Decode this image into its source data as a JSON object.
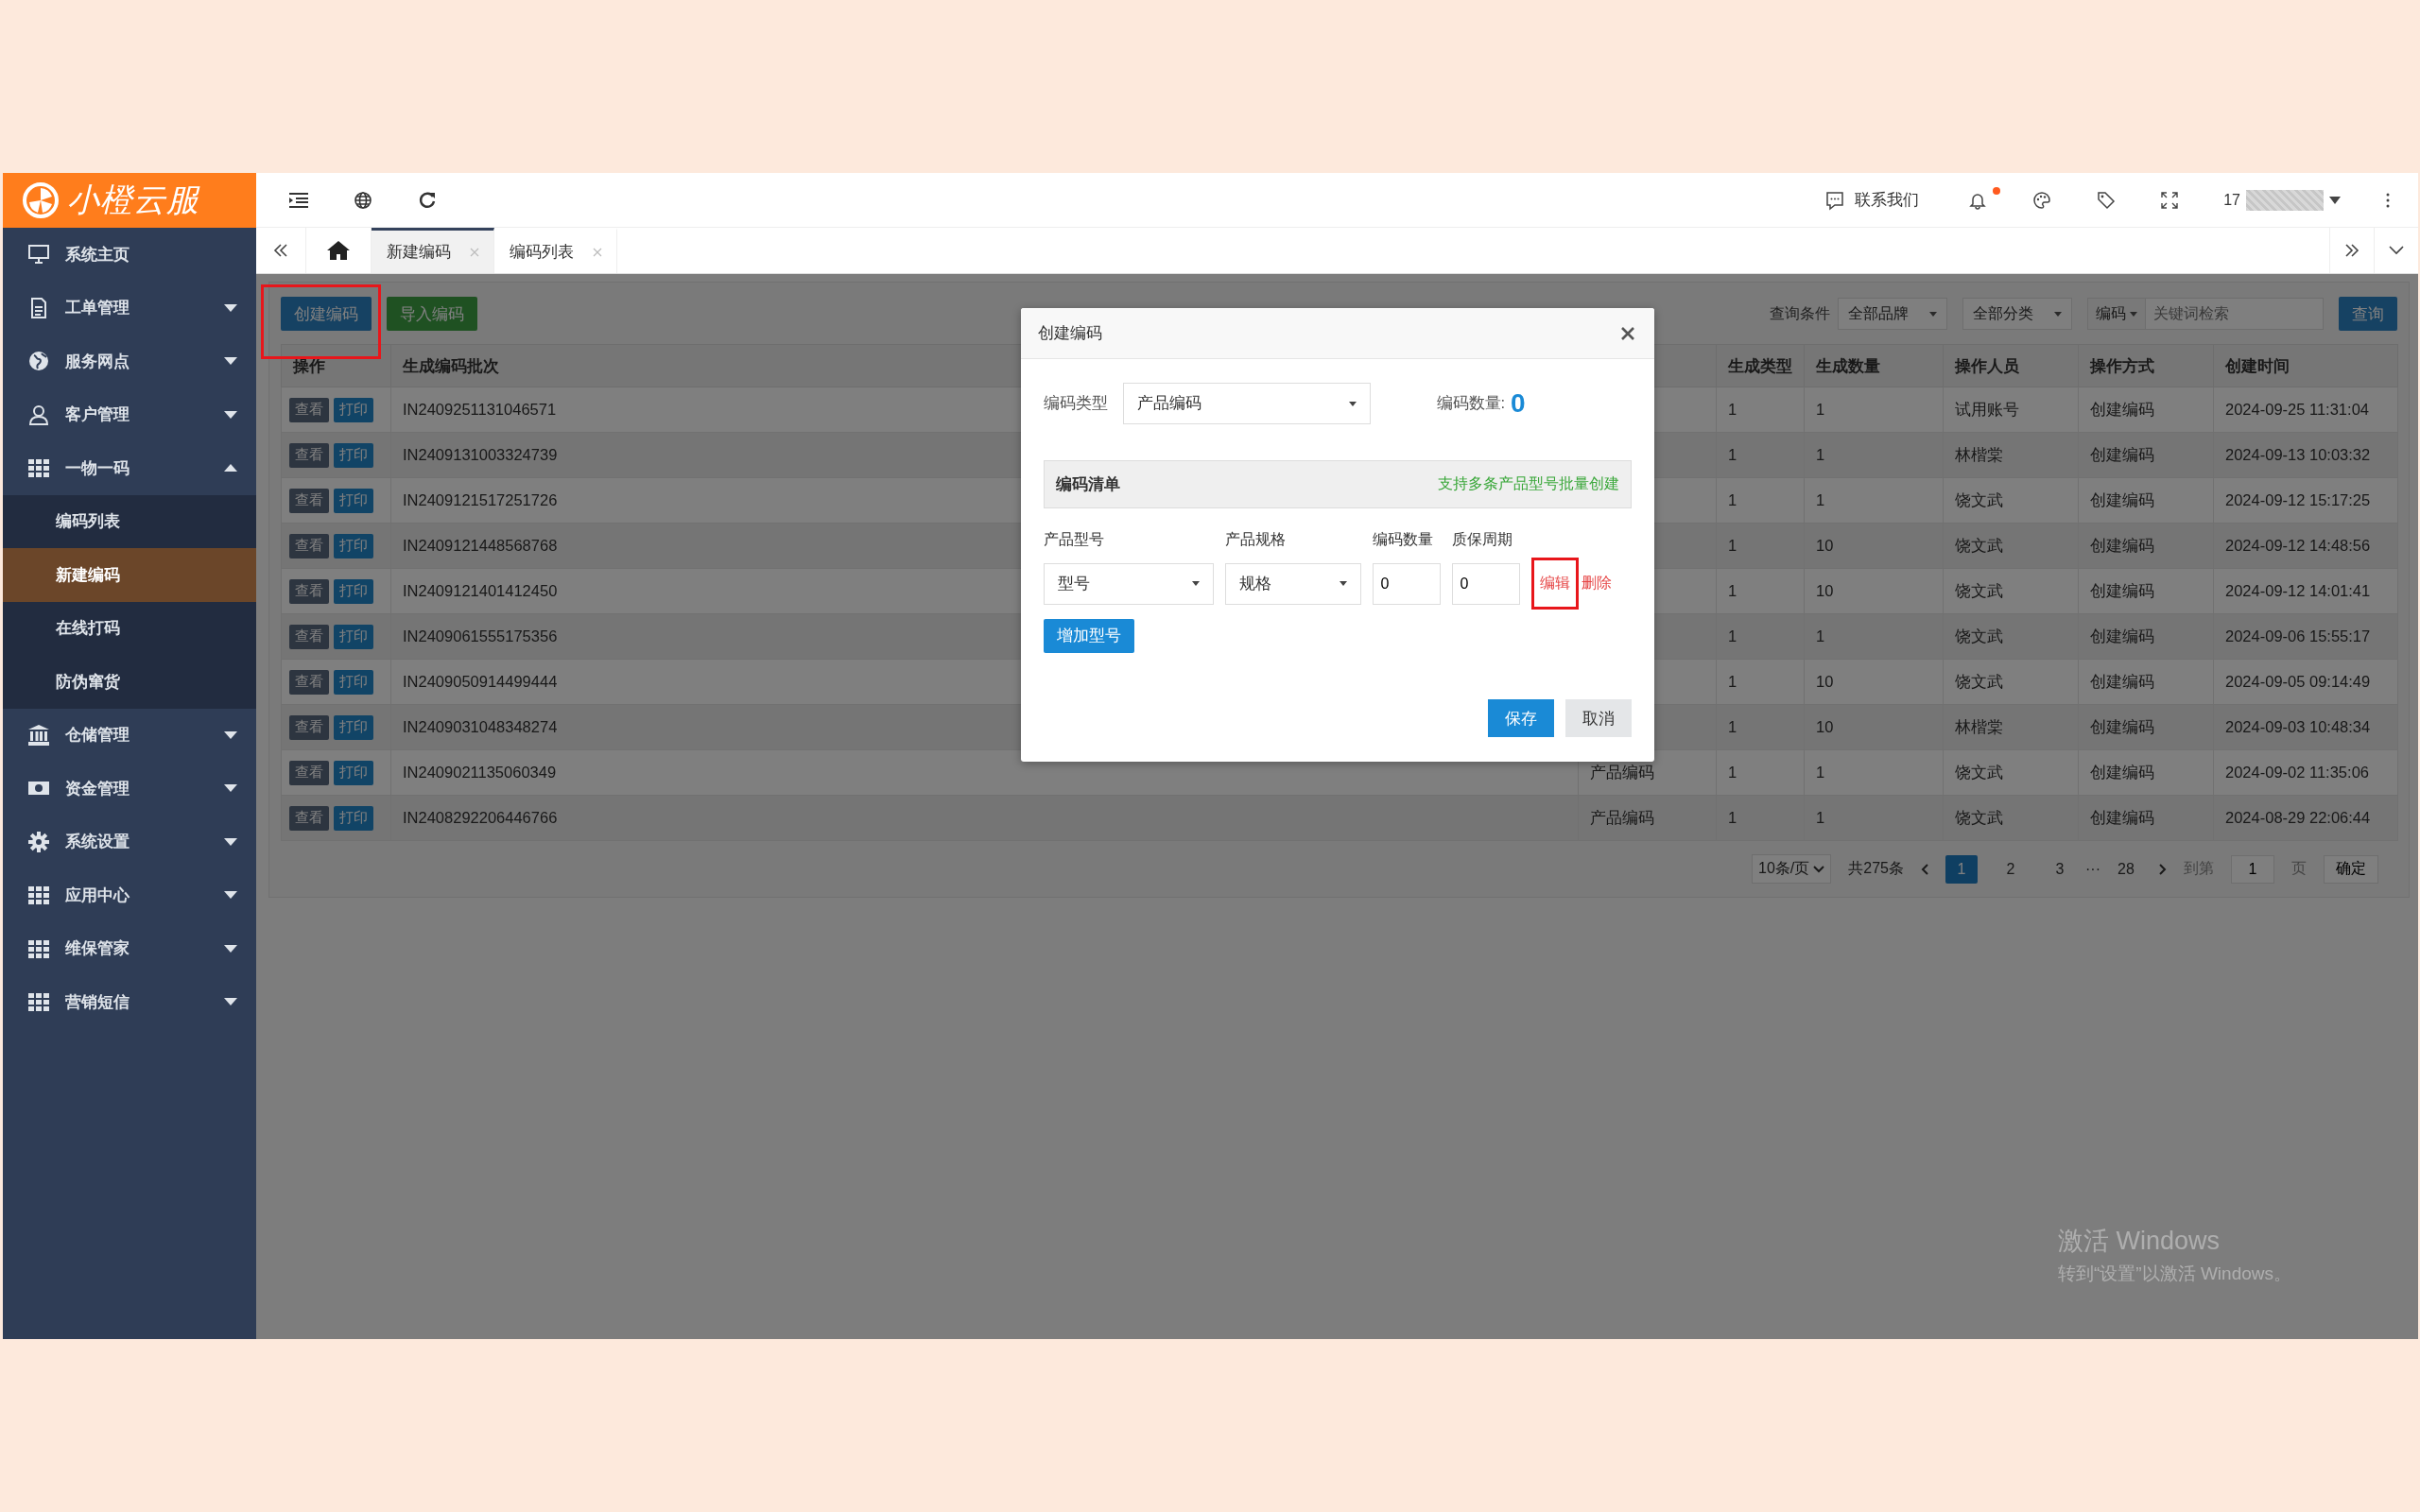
{
  "logo": {
    "text": "小橙云服"
  },
  "sidebar": {
    "items": [
      {
        "label": "系统主页",
        "kind": "link"
      },
      {
        "label": "工单管理",
        "kind": "menu",
        "expanded": false
      },
      {
        "label": "服务网点",
        "kind": "menu",
        "expanded": false
      },
      {
        "label": "客户管理",
        "kind": "menu",
        "expanded": false
      },
      {
        "label": "一物一码",
        "kind": "menu",
        "expanded": true,
        "children": [
          {
            "label": "编码列表",
            "selected": false
          },
          {
            "label": "新建编码",
            "selected": true
          },
          {
            "label": "在线打码",
            "selected": false
          },
          {
            "label": "防伪窜货",
            "selected": false
          }
        ]
      },
      {
        "label": "仓储管理",
        "kind": "menu",
        "expanded": false
      },
      {
        "label": "资金管理",
        "kind": "menu",
        "expanded": false
      },
      {
        "label": "系统设置",
        "kind": "menu",
        "expanded": false
      },
      {
        "label": "应用中心",
        "kind": "menu",
        "expanded": false
      },
      {
        "label": "维保管家",
        "kind": "menu",
        "expanded": false
      },
      {
        "label": "营销短信",
        "kind": "menu",
        "expanded": false
      }
    ]
  },
  "header": {
    "contact": "联系我们",
    "unread": true,
    "user": "17"
  },
  "tabs": [
    {
      "label": "新建编码",
      "selected": true
    },
    {
      "label": "编码列表",
      "selected": false
    }
  ],
  "toolbar": {
    "buttons": [
      {
        "label": "创建编码",
        "kind": "primary",
        "highlighted": true
      },
      {
        "label": "导入编码",
        "kind": "success",
        "highlighted": false
      }
    ],
    "query_label": "查询条件",
    "filters": [
      "全部品牌",
      "全部分类"
    ],
    "field_select": "编码",
    "placeholder": "关键词检索",
    "search_button": "查询"
  },
  "table": {
    "headers": {
      "actions": "操作",
      "batch": "生成编码批次",
      "type": "生成类型",
      "quantity": "生成数量",
      "operator": "操作人员",
      "method": "操作方式",
      "created": "创建时间"
    },
    "rows": [
      {
        "actions": [
          "查看",
          "打印"
        ],
        "batch": "IN2409251131046571",
        "type": "1",
        "quantity": "1",
        "operator": "试用账号",
        "method": "创建编码",
        "created": "2024-09-25 11:31:04"
      },
      {
        "actions": [
          "查看",
          "打印"
        ],
        "batch": "IN2409131003324739",
        "type": "1",
        "quantity": "1",
        "operator": "林楷棠",
        "method": "创建编码",
        "created": "2024-09-13 10:03:32"
      },
      {
        "actions": [
          "查看",
          "打印"
        ],
        "batch": "IN2409121517251726",
        "type": "1",
        "quantity": "1",
        "operator": "饶文武",
        "method": "创建编码",
        "created": "2024-09-12 15:17:25"
      },
      {
        "actions": [
          "查看",
          "打印"
        ],
        "batch": "IN2409121448568768",
        "type": "1",
        "quantity": "10",
        "operator": "饶文武",
        "method": "创建编码",
        "created": "2024-09-12 14:48:56"
      },
      {
        "actions": [
          "查看",
          "打印"
        ],
        "batch": "IN2409121401412450",
        "type": "1",
        "quantity": "10",
        "operator": "饶文武",
        "method": "创建编码",
        "created": "2024-09-12 14:01:41"
      },
      {
        "actions": [
          "查看",
          "打印"
        ],
        "batch": "IN2409061555175356",
        "type": "1",
        "quantity": "1",
        "operator": "饶文武",
        "method": "创建编码",
        "created": "2024-09-06 15:55:17"
      },
      {
        "actions": [
          "查看",
          "打印"
        ],
        "batch": "IN2409050914499444",
        "type": "1",
        "quantity": "10",
        "operator": "饶文武",
        "method": "创建编码",
        "created": "2024-09-05 09:14:49"
      },
      {
        "actions": [
          "查看",
          "打印"
        ],
        "batch": "IN2409031048348274",
        "type": "1",
        "quantity": "10",
        "operator": "林楷棠",
        "method": "创建编码",
        "created": "2024-09-03 10:48:34"
      },
      {
        "actions": [
          "查看",
          "打印"
        ],
        "batch": "IN2409021135060349",
        "column_3": "产品编码",
        "type": "1",
        "quantity": "1",
        "operator": "饶文武",
        "method": "创建编码",
        "created": "2024-09-02 11:35:06"
      },
      {
        "actions": [
          "查看",
          "打印"
        ],
        "batch": "IN2408292206446766",
        "column_3": "产品编码",
        "type": "1",
        "quantity": "1",
        "operator": "饶文武",
        "method": "创建编码",
        "created": "2024-08-29 22:06:44"
      }
    ]
  },
  "pagination": {
    "page_size": "10条/页",
    "total": "共275条",
    "pages": [
      {
        "label": "1",
        "selected": true
      },
      {
        "label": "2",
        "selected": false
      },
      {
        "label": "3",
        "selected": false
      }
    ],
    "ellipsis": "···",
    "last_page": "28",
    "goto_label": "到第",
    "goto_value": "1",
    "page_unit": "页",
    "confirm": "确定"
  },
  "modal": {
    "title": "创建编码",
    "type_label": "编码类型",
    "type_value": "产品编码",
    "count_label": "编码数量:",
    "count": "0",
    "section_title": "编码清单",
    "section_hint": "支持多条产品型号批量创建",
    "columns": [
      "产品型号",
      "产品规格",
      "编码数量",
      "质保周期"
    ],
    "lines": [
      {
        "model": "型号",
        "spec": "规格",
        "quantity": "0",
        "warranty": "0",
        "edit": "编辑",
        "delete": "删除",
        "edit_highlighted": true
      }
    ],
    "add_button": "增加型号",
    "save": "保存",
    "cancel": "取消"
  },
  "os_notice": {
    "title": "激活 Windows",
    "subtitle": "转到“设置”以激活 Windows。"
  }
}
